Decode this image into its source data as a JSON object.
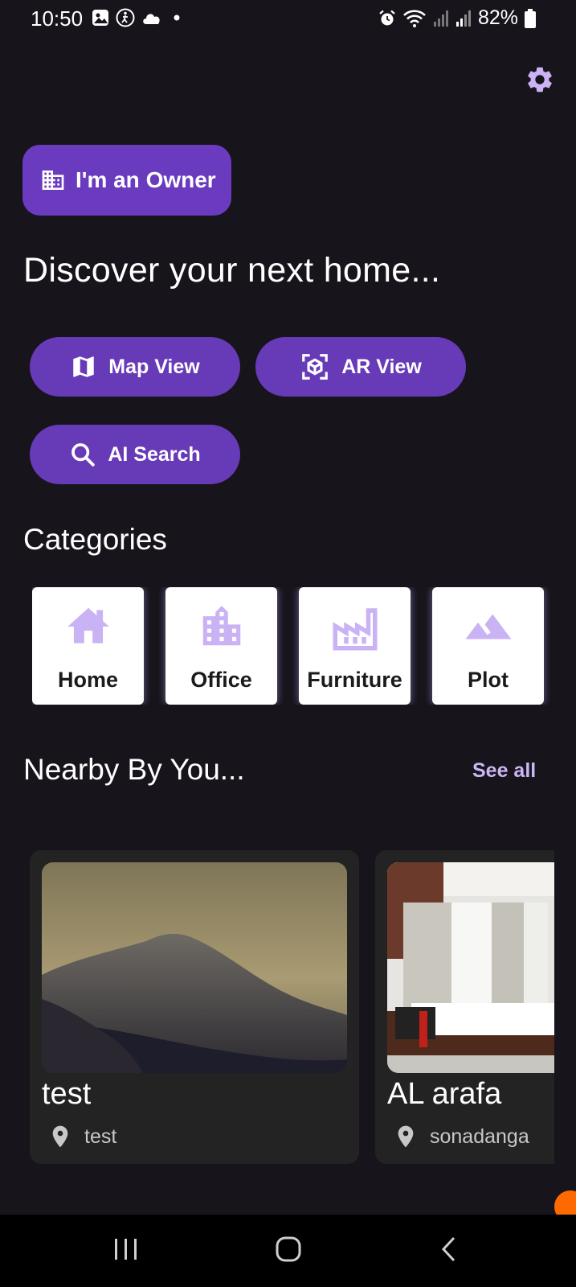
{
  "status_bar": {
    "time": "10:50",
    "battery": "82%",
    "left_icons": [
      "gallery-icon",
      "accessibility-icon",
      "cloud-icon",
      "dot-icon"
    ],
    "right_icons": [
      "alarm-icon",
      "wifi-icon",
      "signal-icon",
      "signal-icon",
      "battery-icon"
    ]
  },
  "header": {
    "settings_icon": "gear-icon",
    "owner_button_label": "I'm an Owner",
    "owner_button_icon": "building-icon",
    "headline": "Discover your next home..."
  },
  "actions": {
    "map_view": "Map View",
    "ar_view": "AR View",
    "ai_search": "AI Search"
  },
  "categories": {
    "title": "Categories",
    "items": [
      {
        "label": "Home",
        "icon": "house-icon"
      },
      {
        "label": "Office",
        "icon": "office-building-icon"
      },
      {
        "label": "Furniture",
        "icon": "factory-icon"
      },
      {
        "label": "Plot",
        "icon": "mountain-icon"
      }
    ]
  },
  "nearby": {
    "title": "Nearby By You...",
    "see_all": "See all",
    "properties": [
      {
        "title": "test",
        "location": "test",
        "image": "mountain-landscape-photo"
      },
      {
        "title": "AL arafa",
        "location": "sonadanga",
        "image": "bedroom-interior-photo"
      }
    ]
  },
  "colors": {
    "background": "#17141b",
    "accent": "#673ab7",
    "icon_tint": "#c9b3f5",
    "card": "#232323"
  },
  "nav": {
    "items": [
      "recent-apps-icon",
      "home-icon",
      "back-icon"
    ]
  }
}
